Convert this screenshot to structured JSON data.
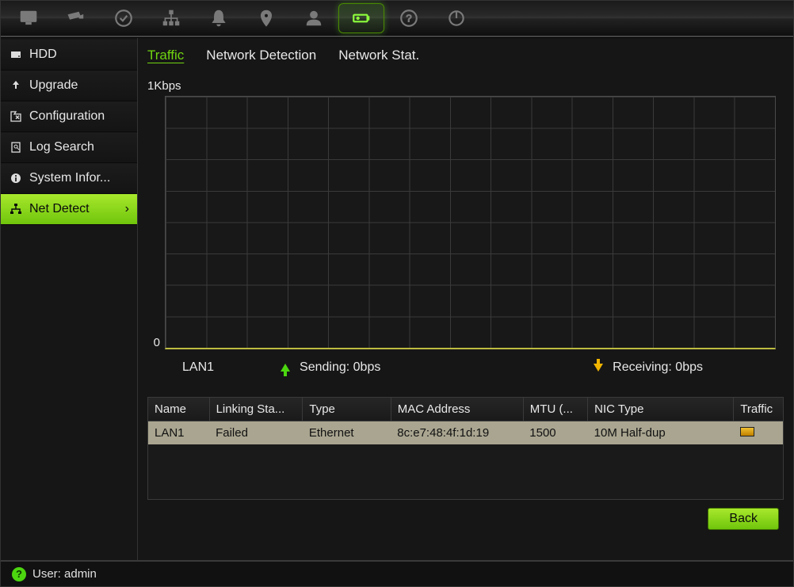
{
  "toolbar": {
    "icons": [
      "monitor",
      "camera",
      "check",
      "network",
      "bell",
      "location",
      "user",
      "battery",
      "help",
      "power"
    ],
    "active_index": 7
  },
  "sidebar": {
    "items": [
      {
        "label": "HDD",
        "icon": "hdd"
      },
      {
        "label": "Upgrade",
        "icon": "upload"
      },
      {
        "label": "Configuration",
        "icon": "config"
      },
      {
        "label": "Log Search",
        "icon": "log"
      },
      {
        "label": "System Infor...",
        "icon": "info"
      },
      {
        "label": "Net Detect",
        "icon": "net",
        "active": true
      }
    ]
  },
  "tabs": [
    {
      "label": "Traffic",
      "active": true
    },
    {
      "label": "Network Detection"
    },
    {
      "label": "Network Stat."
    }
  ],
  "chart_data": {
    "type": "line",
    "title": "",
    "xlabel": "",
    "ylabel": "",
    "ylim": [
      0,
      1
    ],
    "y_unit_label_top": "1Kbps",
    "y_unit_label_bottom": "0",
    "series": [
      {
        "name": "Sending",
        "values": []
      },
      {
        "name": "Receiving",
        "values": []
      }
    ],
    "interface": "LAN1",
    "sending_label": "Sending: 0bps",
    "receiving_label": "Receiving: 0bps"
  },
  "table": {
    "columns": [
      "Name",
      "Linking Sta...",
      "Type",
      "MAC Address",
      "MTU (...",
      "NIC Type",
      "Traffic"
    ],
    "col_widths": [
      "72px",
      "110px",
      "104px",
      "156px",
      "76px",
      "172px",
      "58px"
    ],
    "rows": [
      {
        "name": "LAN1",
        "linking": "Failed",
        "type": "Ethernet",
        "mac": "8c:e7:48:4f:1d:19",
        "mtu": "1500",
        "nic": "10M Half-dup",
        "traffic_icon": true
      }
    ]
  },
  "buttons": {
    "back": "Back"
  },
  "status": {
    "user_label": "User: admin"
  }
}
